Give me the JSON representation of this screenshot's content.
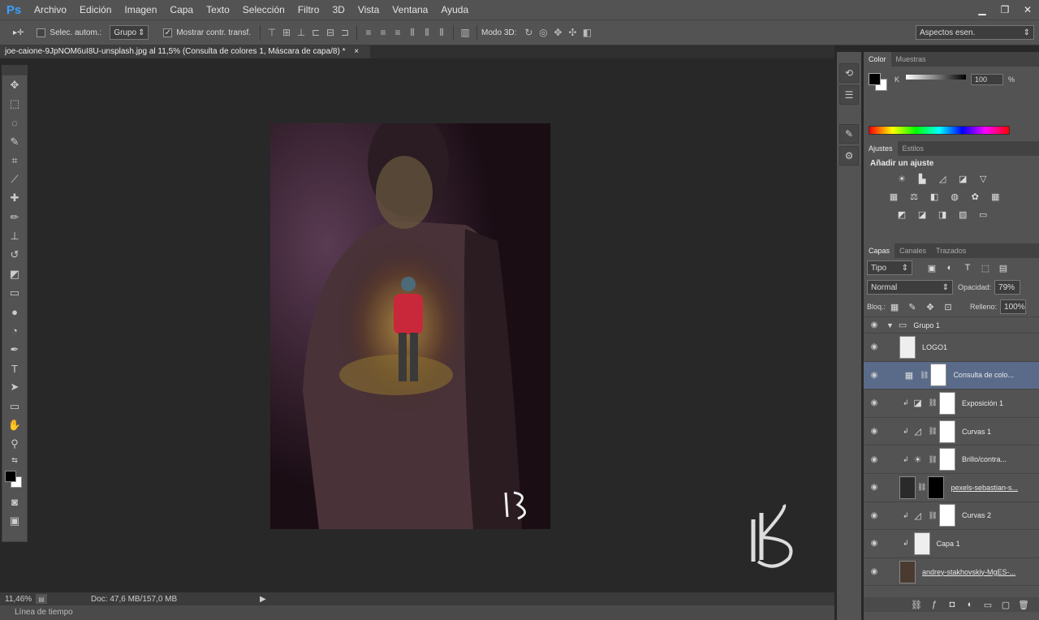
{
  "menubar": {
    "logo": "Ps",
    "items": [
      "Archivo",
      "Edición",
      "Imagen",
      "Capa",
      "Texto",
      "Selección",
      "Filtro",
      "3D",
      "Vista",
      "Ventana",
      "Ayuda"
    ],
    "window_controls": [
      "▁",
      "❐",
      "✕"
    ]
  },
  "options": {
    "move_tool_icon": "▸✛",
    "auto_select_label": "Selec. autom.:",
    "auto_select_value": "Grupo",
    "show_transform_label": "Mostrar contr. transf.",
    "mode3d_label": "Modo 3D:",
    "workspace": "Aspectos esen."
  },
  "document": {
    "tab_title": "joe-caione-9JpNOM6uI8U-unsplash.jpg al 11,5% (Consulta de colores 1, Máscara de capa/8) *",
    "close": "×"
  },
  "status": {
    "zoom": "11,46%",
    "doc_size": "Doc: 47,6 MB/157,0 MB",
    "timeline": "Línea de tiempo"
  },
  "color_panel": {
    "tabs": [
      "Color",
      "Muestras"
    ],
    "channel": "K",
    "value": "100",
    "unit": "%"
  },
  "adjust_panel": {
    "tabs": [
      "Ajustes",
      "Estilos"
    ],
    "title": "Añadir un ajuste"
  },
  "layers_panel": {
    "tabs": [
      "Capas",
      "Canales",
      "Trazados"
    ],
    "kind_filter": "Tipo",
    "blend_mode": "Normal",
    "opacity_label": "Opacidad:",
    "opacity": "79%",
    "lock_label": "Bloq.:",
    "fill_label": "Relleno:",
    "fill": "100%",
    "layers": [
      {
        "name": "Grupo 1",
        "type": "group"
      },
      {
        "name": "LOGO1",
        "type": "smart"
      },
      {
        "name": "Consulta de colo...",
        "type": "adjust",
        "selected": true
      },
      {
        "name": "Exposición 1",
        "type": "adjust"
      },
      {
        "name": "Curvas 1",
        "type": "adjust"
      },
      {
        "name": "Brillo/contra...",
        "type": "adjust"
      },
      {
        "name": "pexels-sebastian-s...",
        "type": "image"
      },
      {
        "name": "Curvas 2",
        "type": "adjust"
      },
      {
        "name": "Capa 1",
        "type": "blank"
      },
      {
        "name": "andrey-stakhovskiy-MgES-...",
        "type": "image"
      }
    ]
  },
  "watermark": "K",
  "colors": {
    "accent": "#3aa0ff",
    "panel": "#535353",
    "selection": "#5a6b8a"
  }
}
